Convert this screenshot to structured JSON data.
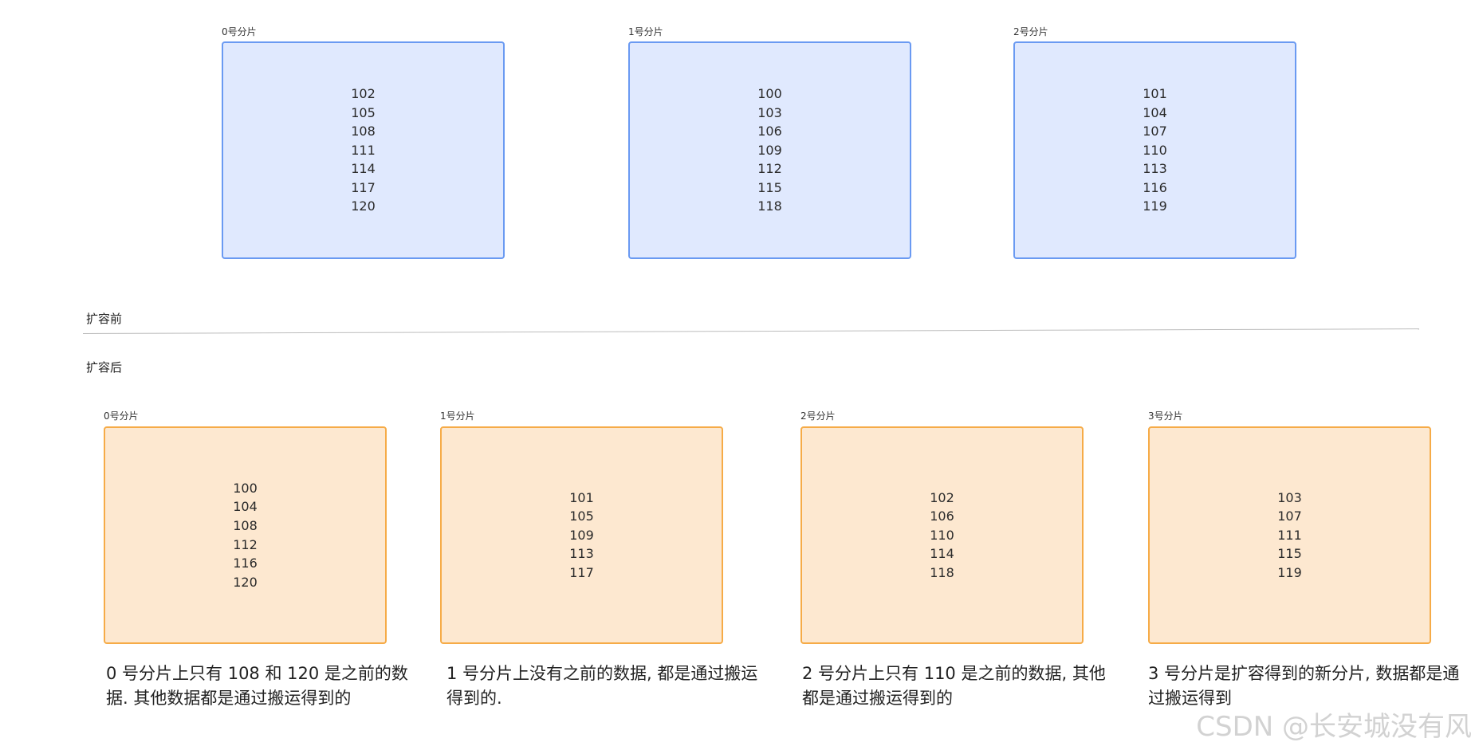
{
  "before": {
    "label": "扩容前",
    "shards": [
      {
        "label": "0号分片",
        "items": [
          "102",
          "105",
          "108",
          "111",
          "114",
          "117",
          "120"
        ]
      },
      {
        "label": "1号分片",
        "items": [
          "100",
          "103",
          "106",
          "109",
          "112",
          "115",
          "118"
        ]
      },
      {
        "label": "2号分片",
        "items": [
          "101",
          "104",
          "107",
          "110",
          "113",
          "116",
          "119"
        ]
      }
    ]
  },
  "after": {
    "label": "扩容后",
    "shards": [
      {
        "label": "0号分片",
        "items": [
          "100",
          "104",
          "108",
          "112",
          "116",
          "120"
        ],
        "caption": "0 号分片上只有 108 和 120 是之前的数据. 其他数据都是通过搬运得到的"
      },
      {
        "label": "1号分片",
        "items": [
          "101",
          "105",
          "109",
          "113",
          "117"
        ],
        "caption": "1 号分片上没有之前的数据, 都是通过搬运得到的."
      },
      {
        "label": "2号分片",
        "items": [
          "102",
          "106",
          "110",
          "114",
          "118"
        ],
        "caption": "2 号分片上只有 110 是之前的数据, 其他都是通过搬运得到的"
      },
      {
        "label": "3号分片",
        "items": [
          "103",
          "107",
          "111",
          "115",
          "119"
        ],
        "caption": "3 号分片是扩容得到的新分片, 数据都是通过搬运得到"
      }
    ]
  },
  "watermark": "CSDN @长安城没有风",
  "colors": {
    "before_fill": "#e0e9fe",
    "before_border": "#6a9af2",
    "after_fill": "#fde8d0",
    "after_border": "#f6ab47"
  }
}
